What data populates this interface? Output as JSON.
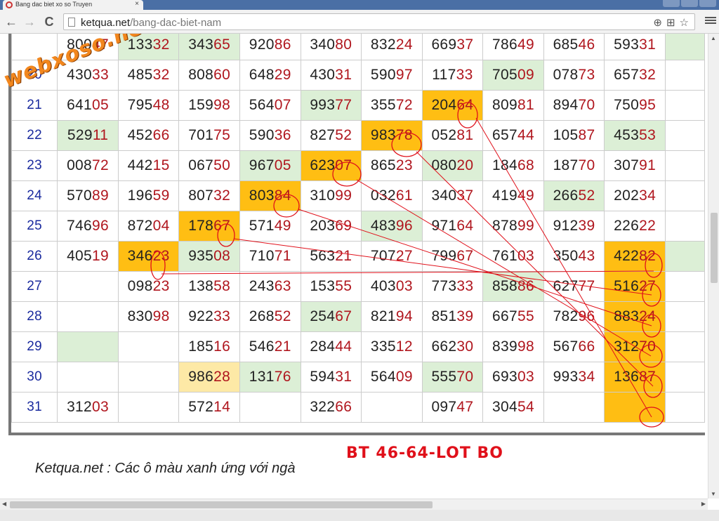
{
  "browser": {
    "tab_title": "Bang dac biet xo so Truyen",
    "tab_close": "×",
    "url_host": "ketqua.net",
    "url_path": "/bang-dac-biet-nam",
    "back_glyph": "←",
    "forward_glyph": "→",
    "reload_glyph": "C"
  },
  "icons": {
    "zoom": "zoom-icon",
    "translate": "translate-icon",
    "star": "bookmark-star-icon",
    "menu": "menu-icon"
  },
  "colors": {
    "green_cell": "#dcefd6",
    "orange_cell": "#ffbe13",
    "light_yellow_cell": "#fde9a6",
    "tail_digits": "#b0161e",
    "day_number": "#1a2a9e",
    "annotation_red": "#e0101a",
    "watermark_orange": "#f2871e"
  },
  "table": {
    "rows": [
      {
        "day": "",
        "cells": [
          {
            "v": "80047",
            "c": ""
          },
          {
            "v": "13332",
            "c": "green"
          },
          {
            "v": "34365",
            "c": "green"
          },
          {
            "v": "92086",
            "c": ""
          },
          {
            "v": "34080",
            "c": ""
          },
          {
            "v": "83224",
            "c": ""
          },
          {
            "v": "66937",
            "c": ""
          },
          {
            "v": "78649",
            "c": ""
          },
          {
            "v": "68546",
            "c": ""
          },
          {
            "v": "59331",
            "c": ""
          }
        ],
        "edge": "green"
      },
      {
        "day": "20",
        "cells": [
          {
            "v": "43033",
            "c": ""
          },
          {
            "v": "48532",
            "c": ""
          },
          {
            "v": "80860",
            "c": ""
          },
          {
            "v": "64829",
            "c": ""
          },
          {
            "v": "43031",
            "c": ""
          },
          {
            "v": "59097",
            "c": ""
          },
          {
            "v": "11733",
            "c": ""
          },
          {
            "v": "70509",
            "c": "green"
          },
          {
            "v": "07873",
            "c": ""
          },
          {
            "v": "65732",
            "c": ""
          }
        ],
        "edge": ""
      },
      {
        "day": "21",
        "cells": [
          {
            "v": "64105",
            "c": ""
          },
          {
            "v": "79548",
            "c": ""
          },
          {
            "v": "15998",
            "c": ""
          },
          {
            "v": "56407",
            "c": ""
          },
          {
            "v": "99377",
            "c": "green"
          },
          {
            "v": "35572",
            "c": ""
          },
          {
            "v": "20464",
            "c": "orange"
          },
          {
            "v": "80981",
            "c": ""
          },
          {
            "v": "89470",
            "c": ""
          },
          {
            "v": "75095",
            "c": ""
          }
        ],
        "edge": ""
      },
      {
        "day": "22",
        "cells": [
          {
            "v": "52911",
            "c": "green"
          },
          {
            "v": "45266",
            "c": ""
          },
          {
            "v": "70175",
            "c": ""
          },
          {
            "v": "59036",
            "c": ""
          },
          {
            "v": "82752",
            "c": ""
          },
          {
            "v": "98378",
            "c": "orange"
          },
          {
            "v": "05281",
            "c": ""
          },
          {
            "v": "65744",
            "c": ""
          },
          {
            "v": "10587",
            "c": ""
          },
          {
            "v": "45353",
            "c": "green"
          }
        ],
        "edge": ""
      },
      {
        "day": "23",
        "cells": [
          {
            "v": "00872",
            "c": ""
          },
          {
            "v": "44215",
            "c": ""
          },
          {
            "v": "06750",
            "c": ""
          },
          {
            "v": "96705",
            "c": "green"
          },
          {
            "v": "62307",
            "c": "orange"
          },
          {
            "v": "86523",
            "c": ""
          },
          {
            "v": "08020",
            "c": "green"
          },
          {
            "v": "18468",
            "c": ""
          },
          {
            "v": "18770",
            "c": ""
          },
          {
            "v": "30791",
            "c": ""
          }
        ],
        "edge": ""
      },
      {
        "day": "24",
        "cells": [
          {
            "v": "57089",
            "c": ""
          },
          {
            "v": "19659",
            "c": ""
          },
          {
            "v": "80732",
            "c": ""
          },
          {
            "v": "80384",
            "c": "orange"
          },
          {
            "v": "31099",
            "c": ""
          },
          {
            "v": "03261",
            "c": ""
          },
          {
            "v": "34037",
            "c": ""
          },
          {
            "v": "41949",
            "c": ""
          },
          {
            "v": "26652",
            "c": "green"
          },
          {
            "v": "20234",
            "c": ""
          }
        ],
        "edge": ""
      },
      {
        "day": "25",
        "cells": [
          {
            "v": "74696",
            "c": ""
          },
          {
            "v": "87204",
            "c": ""
          },
          {
            "v": "17867",
            "c": "orange"
          },
          {
            "v": "57149",
            "c": ""
          },
          {
            "v": "20369",
            "c": ""
          },
          {
            "v": "48396",
            "c": "green"
          },
          {
            "v": "97164",
            "c": ""
          },
          {
            "v": "87899",
            "c": ""
          },
          {
            "v": "91239",
            "c": ""
          },
          {
            "v": "22622",
            "c": ""
          }
        ],
        "edge": ""
      },
      {
        "day": "26",
        "cells": [
          {
            "v": "40519",
            "c": ""
          },
          {
            "v": "34623",
            "c": "orange"
          },
          {
            "v": "93508",
            "c": "green"
          },
          {
            "v": "71071",
            "c": ""
          },
          {
            "v": "56321",
            "c": ""
          },
          {
            "v": "70727",
            "c": ""
          },
          {
            "v": "79967",
            "c": ""
          },
          {
            "v": "76103",
            "c": ""
          },
          {
            "v": "35043",
            "c": ""
          },
          {
            "v": "42282",
            "c": "orange"
          }
        ],
        "edge": "green"
      },
      {
        "day": "27",
        "cells": [
          {
            "v": "",
            "c": ""
          },
          {
            "v": "09823",
            "c": ""
          },
          {
            "v": "13858",
            "c": ""
          },
          {
            "v": "24363",
            "c": ""
          },
          {
            "v": "15355",
            "c": ""
          },
          {
            "v": "40303",
            "c": ""
          },
          {
            "v": "77333",
            "c": ""
          },
          {
            "v": "85886",
            "c": "green"
          },
          {
            "v": "62777",
            "c": ""
          },
          {
            "v": "51627",
            "c": "orange"
          }
        ],
        "edge": ""
      },
      {
        "day": "28",
        "cells": [
          {
            "v": "",
            "c": ""
          },
          {
            "v": "83098",
            "c": ""
          },
          {
            "v": "92233",
            "c": ""
          },
          {
            "v": "26852",
            "c": ""
          },
          {
            "v": "25467",
            "c": "green"
          },
          {
            "v": "82194",
            "c": ""
          },
          {
            "v": "85139",
            "c": ""
          },
          {
            "v": "66755",
            "c": ""
          },
          {
            "v": "78296",
            "c": ""
          },
          {
            "v": "88324",
            "c": "orange"
          }
        ],
        "edge": ""
      },
      {
        "day": "29",
        "cells": [
          {
            "v": "",
            "c": "green"
          },
          {
            "v": "",
            "c": ""
          },
          {
            "v": "18516",
            "c": ""
          },
          {
            "v": "54621",
            "c": ""
          },
          {
            "v": "28444",
            "c": ""
          },
          {
            "v": "33512",
            "c": ""
          },
          {
            "v": "66230",
            "c": ""
          },
          {
            "v": "83998",
            "c": ""
          },
          {
            "v": "56766",
            "c": ""
          },
          {
            "v": "31270",
            "c": "orange"
          }
        ],
        "edge": ""
      },
      {
        "day": "30",
        "cells": [
          {
            "v": "",
            "c": ""
          },
          {
            "v": "",
            "c": ""
          },
          {
            "v": "98628",
            "c": "lightyellow"
          },
          {
            "v": "13176",
            "c": "green"
          },
          {
            "v": "59431",
            "c": ""
          },
          {
            "v": "56409",
            "c": ""
          },
          {
            "v": "55570",
            "c": "green"
          },
          {
            "v": "69303",
            "c": ""
          },
          {
            "v": "99334",
            "c": ""
          },
          {
            "v": "13687",
            "c": "orange"
          }
        ],
        "edge": ""
      },
      {
        "day": "31",
        "cells": [
          {
            "v": "31203",
            "c": ""
          },
          {
            "v": "",
            "c": ""
          },
          {
            "v": "57214",
            "c": ""
          },
          {
            "v": "",
            "c": ""
          },
          {
            "v": "32266",
            "c": ""
          },
          {
            "v": "",
            "c": ""
          },
          {
            "v": "09747",
            "c": ""
          },
          {
            "v": "30454",
            "c": ""
          },
          {
            "v": "",
            "c": ""
          },
          {
            "v": "",
            "c": "orange"
          }
        ],
        "edge": ""
      }
    ]
  },
  "annotation": "BT 46-64-LOT BO",
  "watermark": "webxoso.net",
  "footnote": "Ketqua.net : Các ô màu xanh ứng với ngà"
}
